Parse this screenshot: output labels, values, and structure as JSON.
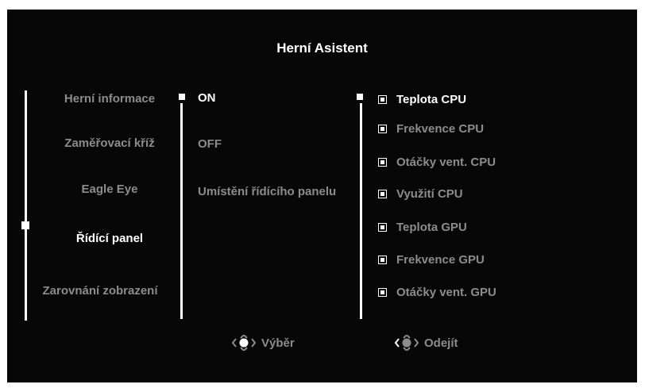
{
  "title": "Herní Asistent",
  "menu": [
    {
      "label": "Herní informace",
      "active": false
    },
    {
      "label": "Zaměřovací kříž",
      "active": false
    },
    {
      "label": "Eagle Eye",
      "active": false
    },
    {
      "label": "Řídící panel",
      "active": true
    },
    {
      "label": "Zarovnání zobrazení",
      "active": false
    }
  ],
  "options": [
    {
      "label": "ON",
      "active": true
    },
    {
      "label": "OFF",
      "active": false
    },
    {
      "label": "Umístění řídícího panelu",
      "active": false
    }
  ],
  "metrics": [
    {
      "label": "Teplota CPU",
      "checked": true,
      "active": true
    },
    {
      "label": "Frekvence CPU",
      "checked": true,
      "active": false
    },
    {
      "label": "Otáčky vent. CPU",
      "checked": true,
      "active": false
    },
    {
      "label": "Využití CPU",
      "checked": true,
      "active": false
    },
    {
      "label": "Teplota GPU",
      "checked": true,
      "active": false
    },
    {
      "label": "Frekvence GPU",
      "checked": true,
      "active": false
    },
    {
      "label": "Otáčky vent. GPU",
      "checked": true,
      "active": false
    }
  ],
  "hints": {
    "select": {
      "label": "Výběr",
      "icon": "joystick-icon"
    },
    "exit": {
      "label": "Odejít",
      "icon": "joystick-icon"
    }
  },
  "colors": {
    "background": "#070707",
    "active": "#ffffff",
    "inactive": "#8c8c8c"
  }
}
